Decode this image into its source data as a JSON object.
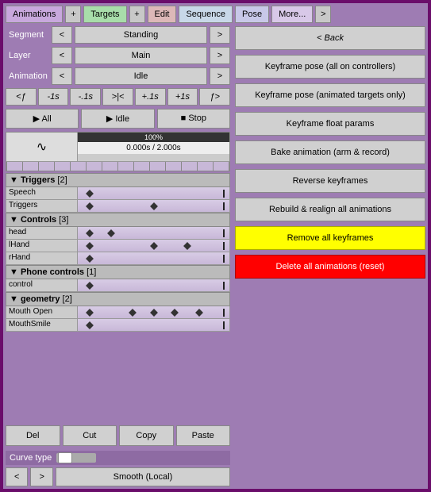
{
  "tabs": {
    "animations": "Animations",
    "targets": "Targets",
    "edit": "Edit",
    "sequence": "Sequence",
    "pose": "Pose",
    "more": "More...",
    "plus": "+",
    "next": ">"
  },
  "selectors": {
    "segment_label": "Segment",
    "segment_value": "Standing",
    "layer_label": "Layer",
    "layer_value": "Main",
    "animation_label": "Animation",
    "animation_value": "Idle",
    "prev": "<",
    "next": ">"
  },
  "timing": {
    "f_back": "<ƒ",
    "back_1s": "-1s",
    "back_01s": "-.1s",
    "reset": ">|<",
    "fwd_01s": "+.1s",
    "fwd_1s": "+1s",
    "f_fwd": "ƒ>"
  },
  "playback": {
    "all": "▶ All",
    "idle": "▶ Idle",
    "stop": "■ Stop"
  },
  "timeline": {
    "percent": "100%",
    "time": "0.000s / 2.000s",
    "wave": "∿"
  },
  "sections": {
    "triggers": {
      "label": "▼ Triggers",
      "count": "[2]",
      "tracks": [
        {
          "name": "Speech",
          "keyframes": [
            8
          ]
        },
        {
          "name": "Triggers",
          "keyframes": [
            8,
            50
          ]
        }
      ]
    },
    "controls": {
      "label": "▼ Controls",
      "count": "[3]",
      "tracks": [
        {
          "name": "head",
          "keyframes": [
            8,
            22
          ]
        },
        {
          "name": "lHand",
          "keyframes": [
            8,
            50,
            72
          ]
        },
        {
          "name": "rHand",
          "keyframes": [
            8
          ]
        }
      ]
    },
    "phone": {
      "label": "▼ Phone controls",
      "count": "[1]",
      "tracks": [
        {
          "name": "control",
          "keyframes": [
            8
          ]
        }
      ]
    },
    "geometry": {
      "label": "▼ geometry",
      "count": "[2]",
      "tracks": [
        {
          "name": "Mouth Open",
          "keyframes": [
            8,
            36,
            50,
            64,
            80
          ]
        },
        {
          "name": "MouthSmile",
          "keyframes": [
            8
          ]
        }
      ]
    }
  },
  "edit_buttons": {
    "del": "Del",
    "cut": "Cut",
    "copy": "Copy",
    "paste": "Paste"
  },
  "curve": {
    "label": "Curve type",
    "prev": "<",
    "next": ">",
    "name": "Smooth (Local)"
  },
  "right_panel": {
    "back": "< Back",
    "kf_all": "Keyframe pose (all on controllers)",
    "kf_anim": "Keyframe pose (animated targets only)",
    "kf_float": "Keyframe float params",
    "bake": "Bake animation (arm & record)",
    "reverse": "Reverse keyframes",
    "rebuild": "Rebuild & realign all animations",
    "remove": "Remove all keyframes",
    "delete": "Delete all animations (reset)"
  }
}
